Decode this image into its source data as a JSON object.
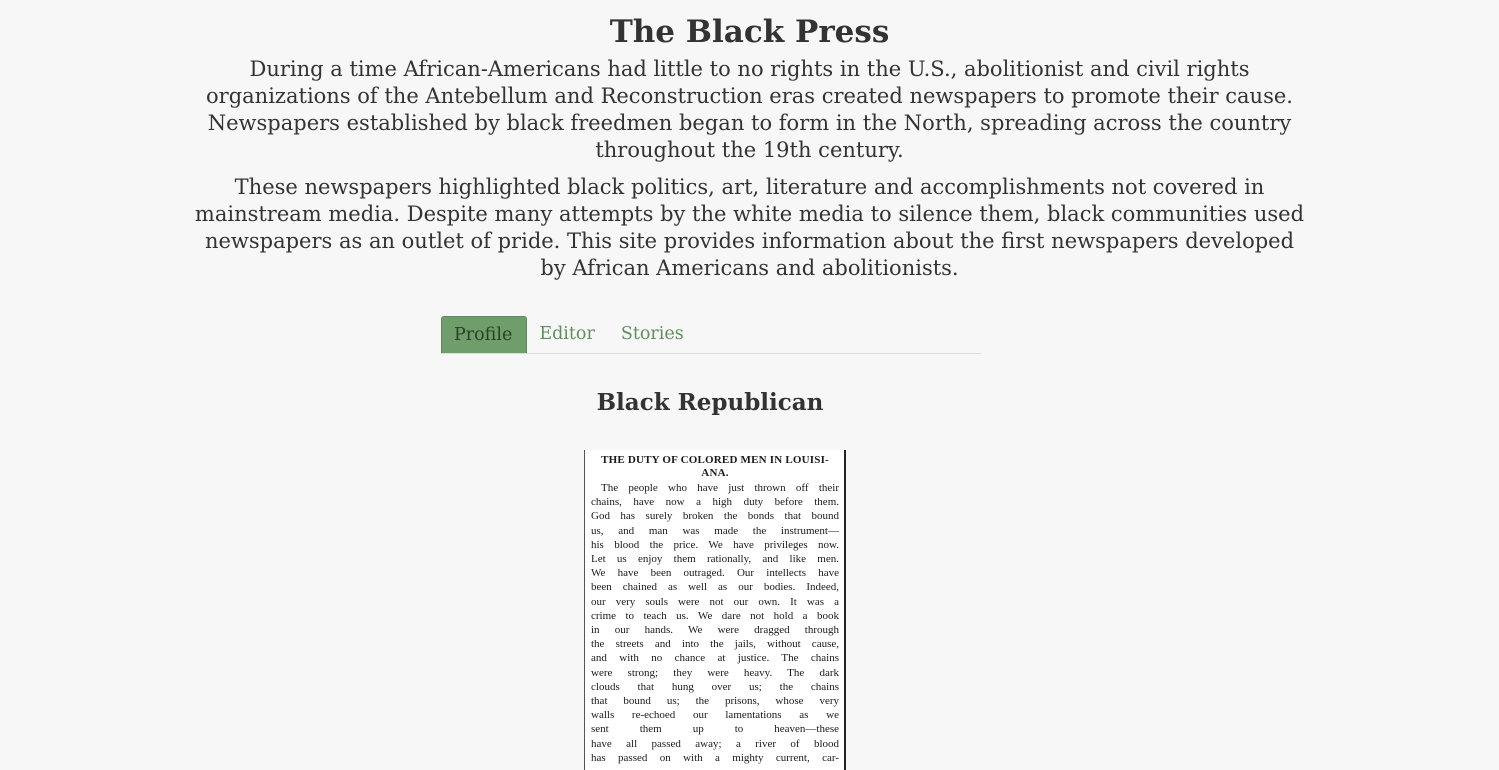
{
  "header": {
    "title": "The Black Press",
    "paragraphs": [
      "During a time African-Americans had little to no rights in the U.S., abolitionist and civil rights organizations of the Antebellum and Reconstruction eras created newspapers to promote their cause. Newspapers established by black freedmen began to form in the North, spreading across the country throughout the 19th century.",
      "These newspapers highlighted black politics, art, literature and accomplishments not covered in mainstream media. Despite many attempts by the white media to silence them, black communities used newspapers as an outlet of pride. This site provides information about the first newspapers developed by African Americans and abolitionists."
    ]
  },
  "tabs": [
    {
      "label": "Profile",
      "active": true
    },
    {
      "label": "Editor",
      "active": false
    },
    {
      "label": "Stories",
      "active": false
    }
  ],
  "profile": {
    "paper_name": "Black Republican",
    "clipping": {
      "headline_1": "THE DUTY OF COLORED MEN IN LOUISI-",
      "headline_2": "ANA.",
      "lines": [
        "The people who have just thrown off their",
        "chains, have now a high duty before them.",
        "God has surely broken the bonds that bound",
        "us, and man was made the instrument—",
        "his blood the price. We have privileges now.",
        "Let us enjoy them rationally, and like men.",
        "We have been outraged. Our intellects have",
        "been chained as well as our bodies. Indeed,",
        "our very souls were not our own. It was a",
        "crime to teach us. We dare not hold a book",
        "in our hands. We were dragged through",
        "the streets and into the jails, without cause,",
        "and with no chance at justice. The chains",
        "were strong; they were heavy. The dark",
        "clouds that hung over us; the chains",
        "that bound us; the prisons, whose very",
        "walls re-echoed our lamentations as we",
        "sent them up to heaven—these",
        "have all passed away; a river of blood",
        "has passed on with a mighty current, car-"
      ]
    }
  },
  "colors": {
    "background": "#f7f7f7",
    "text": "#333333",
    "tab_active_bg": "#6f9e6a",
    "tab_text": "#5f8f5c"
  }
}
